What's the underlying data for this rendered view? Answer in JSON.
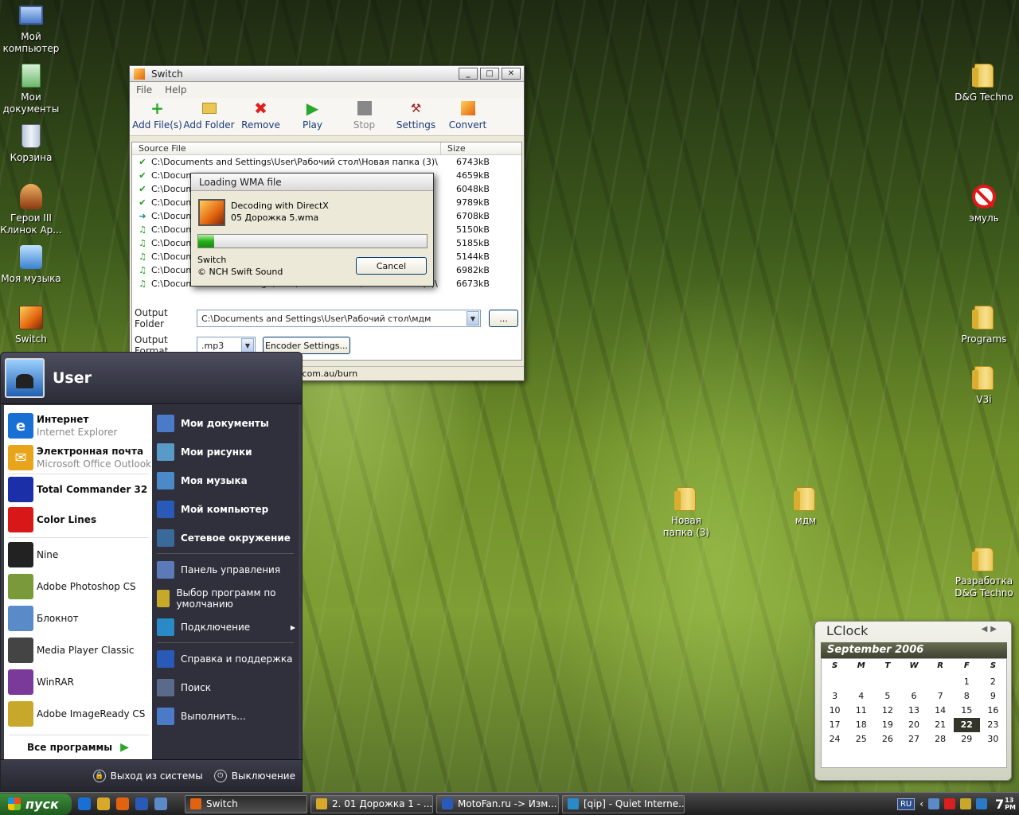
{
  "desktop": {
    "left_icons": [
      {
        "label": "Мой компьютер",
        "icon": "computer-icon"
      },
      {
        "label": "Мои документы",
        "icon": "documents-icon"
      },
      {
        "label": "Корзина",
        "icon": "recycle-bin-icon"
      },
      {
        "label": "Герои III Клинок Ар...",
        "icon": "game-icon"
      },
      {
        "label": "Моя музыка",
        "icon": "music-icon"
      },
      {
        "label": "Switch",
        "icon": "switch-app-icon"
      }
    ],
    "right_icons": [
      {
        "label": "D&G Techno",
        "icon": "folder-icon"
      },
      {
        "label": "эмуль",
        "icon": "forbidden-icon"
      },
      {
        "label": "Programs",
        "icon": "folder-icon"
      },
      {
        "label": "V3i",
        "icon": "folder-icon"
      },
      {
        "label": "Разработка D&G Techno",
        "icon": "folder-icon"
      }
    ],
    "middle_icons": [
      {
        "label": "Новая папка (3)",
        "icon": "folder-icon"
      },
      {
        "label": "мдм",
        "icon": "folder-icon"
      }
    ]
  },
  "switch": {
    "title": "Switch",
    "menu": [
      "File",
      "Help"
    ],
    "toolbar": [
      {
        "label": "Add File(s)",
        "icon": "add-icon"
      },
      {
        "label": "Add Folder",
        "icon": "add-folder-icon"
      },
      {
        "label": "Remove",
        "icon": "remove-icon"
      },
      {
        "label": "Play",
        "icon": "play-icon"
      },
      {
        "label": "Stop",
        "icon": "stop-icon"
      },
      {
        "label": "Settings",
        "icon": "settings-icon"
      },
      {
        "label": "Convert",
        "icon": "convert-icon"
      }
    ],
    "columns": [
      "Source File",
      "Size"
    ],
    "files": [
      {
        "path": "C:\\Documents and Settings\\User\\Рабочий стол\\Новая папка (3)\\Неизвес...",
        "size": "6743kB",
        "status": "done"
      },
      {
        "path": "C:\\Docume",
        "size": "4659kB",
        "status": "done"
      },
      {
        "path": "C:\\Docume",
        "size": "6048kB",
        "status": "done"
      },
      {
        "path": "C:\\Docume",
        "size": "9789kB",
        "status": "done"
      },
      {
        "path": "C:\\Docume",
        "size": "6708kB",
        "status": "current"
      },
      {
        "path": "C:\\Docume",
        "size": "5150kB",
        "status": "queued"
      },
      {
        "path": "C:\\Docume",
        "size": "5185kB",
        "status": "queued"
      },
      {
        "path": "C:\\Docume",
        "size": "5144kB",
        "status": "queued"
      },
      {
        "path": "C:\\Docume",
        "size": "6982kB",
        "status": "queued"
      },
      {
        "path": "C:\\Documents and Settings\\User\\Рабочий стол\\Новая папка (3)\\Неизвес...",
        "size": "6673kB",
        "status": "queued"
      }
    ],
    "output_folder_label": "Output Folder",
    "output_folder_value": "C:\\Documents and Settings\\User\\Рабочий стол\\мдм",
    "browse_label": "...",
    "output_format_label": "Output Format",
    "output_format_value": ".mp3",
    "encoder_settings_label": "Encoder Settings...",
    "status_text": "ch.com.au/burn"
  },
  "loading": {
    "title": "Loading WMA file",
    "line1": "Decoding with DirectX",
    "line2": "05 Дорожка 5.wma",
    "progress": 0.07,
    "footer1": "Switch",
    "footer2": "© NCH Swift Sound",
    "cancel_label": "Cancel"
  },
  "start_menu": {
    "user": "User",
    "pinned": [
      {
        "title": "Интернет",
        "subtitle": "Internet Explorer",
        "icon": "ie-icon",
        "color": "#1a6fd4"
      },
      {
        "title": "Электронная почта",
        "subtitle": "Microsoft Office Outlook",
        "icon": "outlook-icon",
        "color": "#e8a51c"
      }
    ],
    "recent": [
      {
        "title": "Total Commander 32",
        "icon": "total-commander-icon",
        "color": "#1a2fa8",
        "bold": true
      },
      {
        "title": "Color Lines",
        "icon": "color-lines-icon",
        "color": "#d81818",
        "bold": true
      },
      {
        "title": "Nine",
        "icon": "nine-icon",
        "color": "#222222",
        "bold": false
      },
      {
        "title": "Adobe Photoshop CS",
        "icon": "photoshop-icon",
        "color": "#7a9a3a",
        "bold": false
      },
      {
        "title": "Блокнот",
        "icon": "notepad-icon",
        "color": "#5a8ac8",
        "bold": false
      },
      {
        "title": "Media Player Classic",
        "icon": "media-player-icon",
        "color": "#444444",
        "bold": false
      },
      {
        "title": "WinRAR",
        "icon": "winrar-icon",
        "color": "#7a3a9a",
        "bold": false
      },
      {
        "title": "Adobe ImageReady CS",
        "icon": "imageready-icon",
        "color": "#c8a82a",
        "bold": false
      }
    ],
    "all_programs": "Все программы",
    "places": [
      {
        "title": "Мои документы",
        "icon": "documents-icon",
        "bold": true
      },
      {
        "title": "Мои рисунки",
        "icon": "pictures-icon",
        "bold": true
      },
      {
        "title": "Моя музыка",
        "icon": "music-icon",
        "bold": true
      },
      {
        "title": "Мой компьютер",
        "icon": "computer-icon",
        "bold": true
      },
      {
        "title": "Сетевое окружение",
        "icon": "network-icon",
        "bold": true
      }
    ],
    "system": [
      {
        "title": "Панель управления",
        "icon": "control-panel-icon"
      },
      {
        "title": "Выбор программ по умолчанию",
        "icon": "default-programs-icon"
      },
      {
        "title": "Подключение",
        "icon": "connect-icon"
      }
    ],
    "help": [
      {
        "title": "Справка и поддержка",
        "icon": "help-icon"
      },
      {
        "title": "Поиск",
        "icon": "search-icon"
      },
      {
        "title": "Выполнить...",
        "icon": "run-icon"
      }
    ],
    "logoff": "Выход из системы",
    "shutdown": "Выключение"
  },
  "taskbar": {
    "start": "пуск",
    "tasks": [
      {
        "label": "Switch",
        "active": true
      },
      {
        "label": "2. 01 Дорожка 1 - ...",
        "active": false
      },
      {
        "label": "MotoFan.ru -> Изм...",
        "active": false
      },
      {
        "label": "[qip] - Quiet Interne...",
        "active": false
      }
    ],
    "lang": "RU",
    "time_hour": "7",
    "time_min": "13",
    "time_ampm": "PM"
  },
  "lclock": {
    "title": "LClock",
    "month": "September 2006",
    "weekdays": [
      "S",
      "M",
      "T",
      "W",
      "R",
      "F",
      "S"
    ],
    "days": [
      "",
      "",
      "",
      "",
      "",
      "1",
      "2",
      "3",
      "4",
      "5",
      "6",
      "7",
      "8",
      "9",
      "10",
      "11",
      "12",
      "13",
      "14",
      "15",
      "16",
      "17",
      "18",
      "19",
      "20",
      "21",
      "22",
      "23",
      "24",
      "25",
      "26",
      "27",
      "28",
      "29",
      "30"
    ],
    "today": "22"
  }
}
